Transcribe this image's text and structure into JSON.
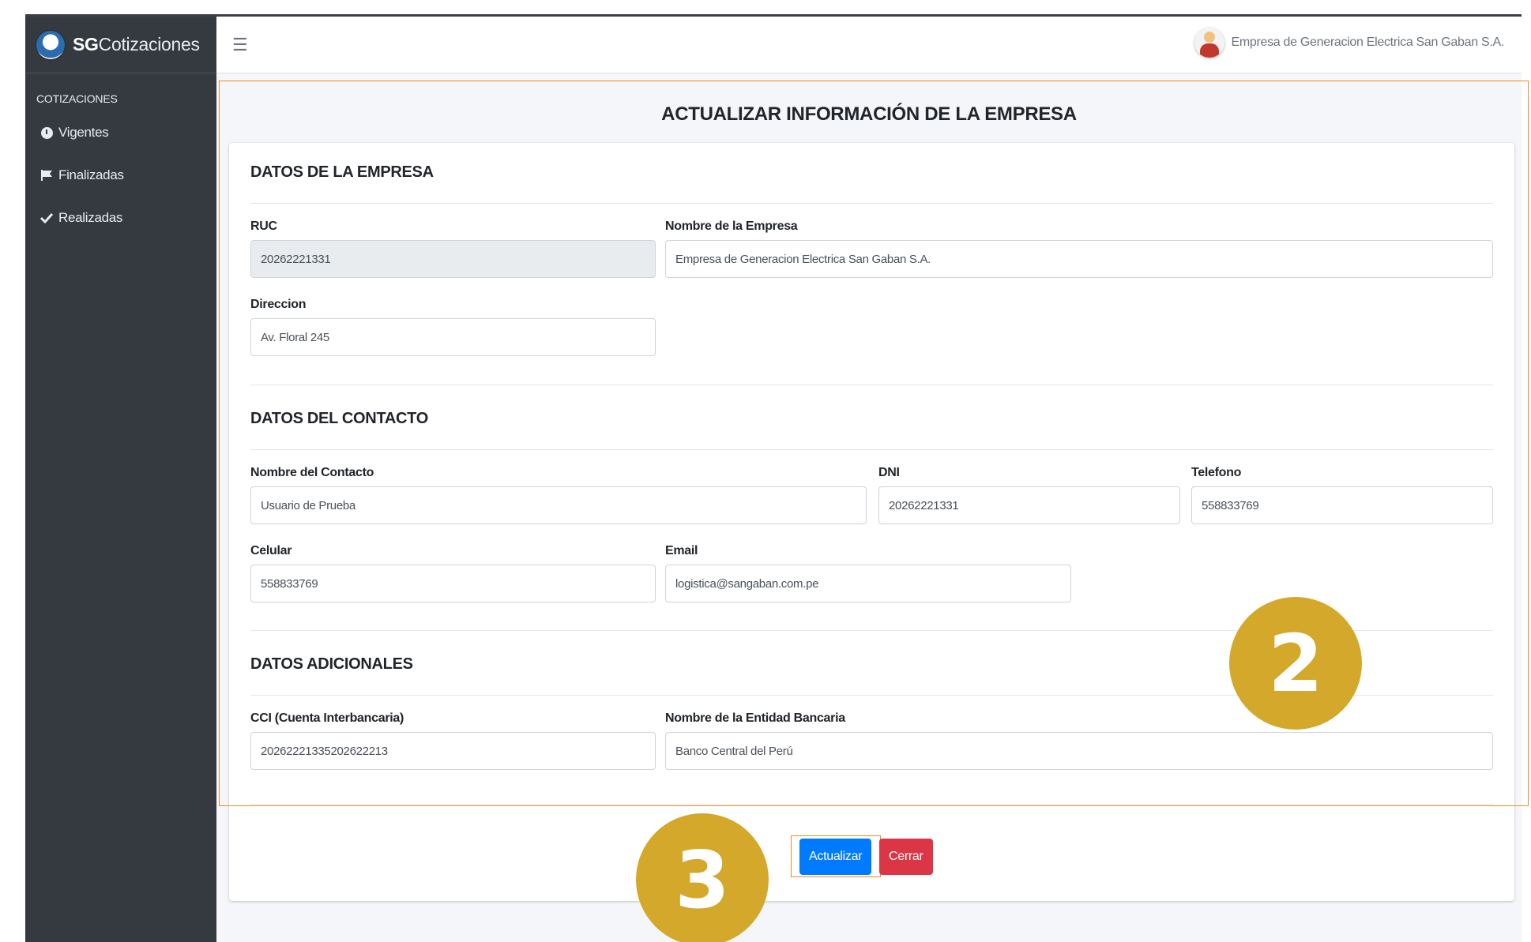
{
  "app": {
    "brand_bold": "SG",
    "brand_rest": "Cotizaciones"
  },
  "sidebar": {
    "header": "COTIZACIONES",
    "items": [
      {
        "label": "Vigentes",
        "icon": "clock-icon"
      },
      {
        "label": "Finalizadas",
        "icon": "flag-icon"
      },
      {
        "label": "Realizadas",
        "icon": "check-icon"
      }
    ]
  },
  "topbar": {
    "menu_icon": "☰",
    "user_name": "Empresa de Generacion Electrica San Gaban S.A."
  },
  "page": {
    "title": "ACTUALIZAR INFORMACIÓN DE LA EMPRESA"
  },
  "empresa": {
    "section_title": "DATOS DE LA EMPRESA",
    "ruc_label": "RUC",
    "ruc_value": "20262221331",
    "nombre_label": "Nombre de la Empresa",
    "nombre_value": "Empresa de Generacion Electrica San Gaban S.A.",
    "direccion_label": "Direccion",
    "direccion_value": "Av. Floral 245"
  },
  "contacto": {
    "section_title": "DATOS DEL CONTACTO",
    "nombre_label": "Nombre del Contacto",
    "nombre_value": "Usuario de Prueba",
    "dni_label": "DNI",
    "dni_value": "20262221331",
    "telefono_label": "Telefono",
    "telefono_value": "558833769",
    "celular_label": "Celular",
    "celular_value": "558833769",
    "email_label": "Email",
    "email_value": "logistica@sangaban.com.pe"
  },
  "adicionales": {
    "section_title": "DATOS ADICIONALES",
    "cci_label": "CCI (Cuenta Interbancaria)",
    "cci_value": "20262221335202622213",
    "banco_label": "Nombre de la Entidad Bancaria",
    "banco_value": "Banco Central del Perú"
  },
  "actions": {
    "update_label": "Actualizar",
    "close_label": "Cerrar"
  },
  "annotations": {
    "step_2": "2",
    "step_3": "3",
    "highlight_color": "#f08a24",
    "badge_color": "#d4a82a"
  }
}
